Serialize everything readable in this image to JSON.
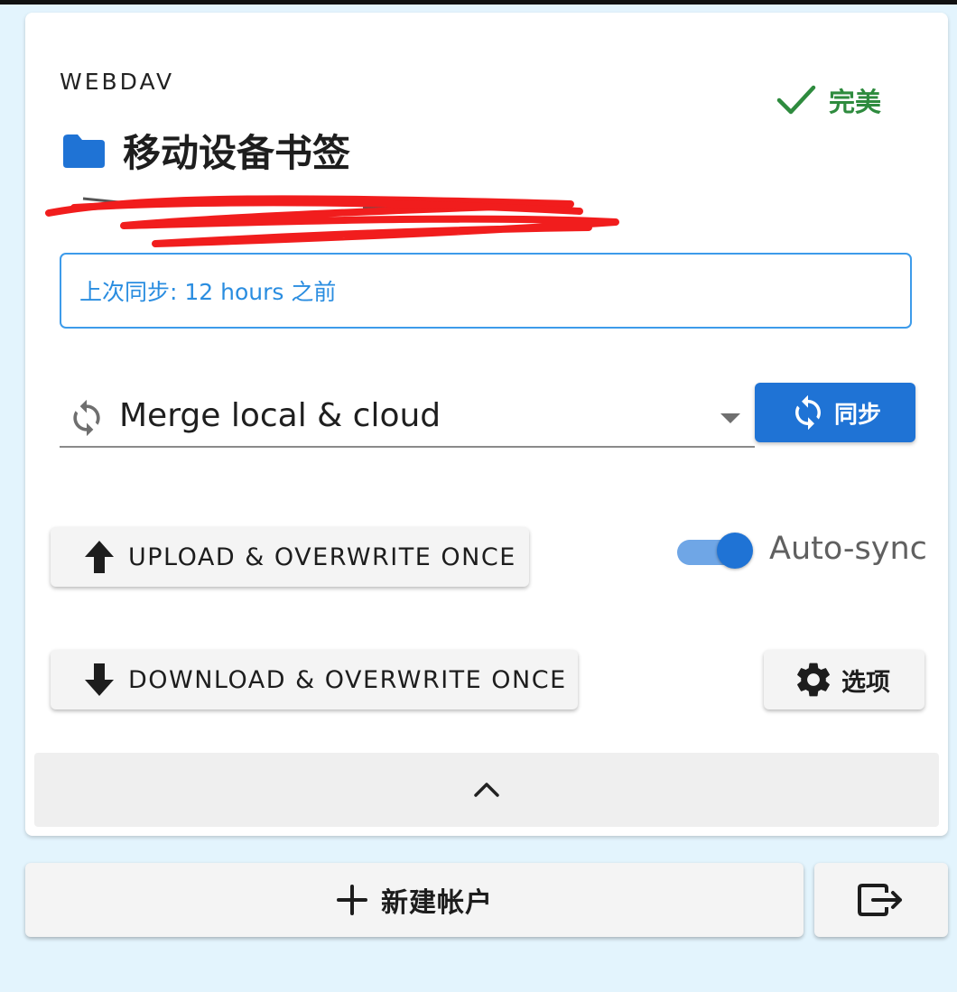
{
  "card": {
    "type_label": "WEBDAV",
    "status": {
      "text": "完美",
      "icon": "check-icon",
      "color": "#2e8b3e"
    },
    "title": {
      "icon": "folder-icon",
      "text": "移动设备书签"
    },
    "last_sync": "上次同步: 12 hours 之前",
    "sync_strategy": {
      "icon": "sync-icon",
      "selected": "Merge local & cloud"
    },
    "sync_button": {
      "icon": "sync-icon",
      "label": "同步"
    },
    "upload_button": {
      "icon": "arrow-up-icon",
      "label": "UPLOAD & OVERWRITE ONCE"
    },
    "auto_sync": {
      "label": "Auto-sync",
      "enabled": true
    },
    "download_button": {
      "icon": "arrow-down-icon",
      "label": "DOWNLOAD & OVERWRITE ONCE"
    },
    "options_button": {
      "icon": "gear-icon",
      "label": "选项"
    },
    "collapse": {
      "icon": "chevron-up-icon"
    }
  },
  "footer": {
    "new_account_button": {
      "icon": "plus-icon",
      "label": "新建帐户"
    },
    "logout_button": {
      "icon": "logout-icon"
    }
  },
  "colors": {
    "accent": "#1f73d5",
    "success": "#2e8b3e",
    "page_background": "#e3f4fd"
  }
}
